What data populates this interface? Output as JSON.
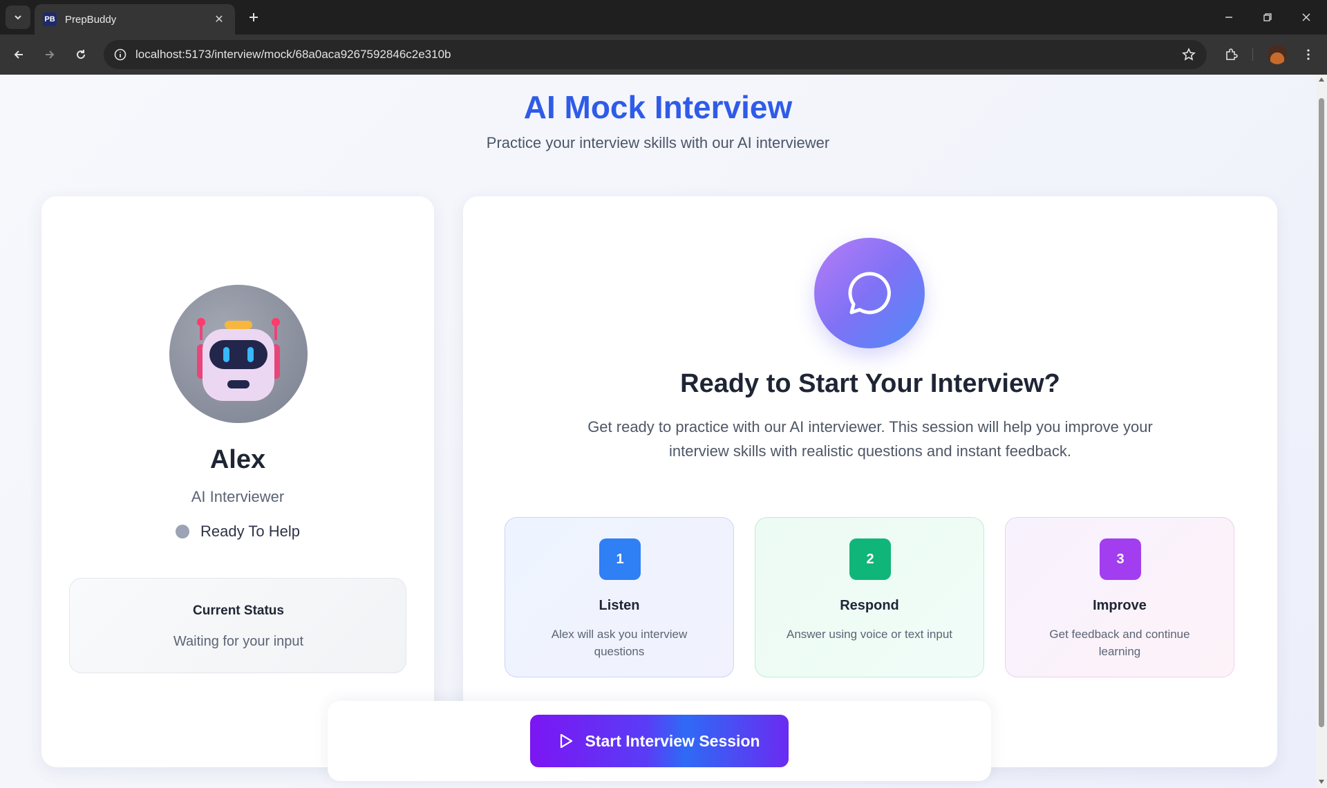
{
  "browser": {
    "tab_title": "PrepBuddy",
    "tab_favicon_text": "PB",
    "url": "localhost:5173/interview/mock/68a0aca9267592846c2e310b"
  },
  "page": {
    "title": "AI Mock Interview",
    "subtitle": "Practice your interview skills with our AI interviewer"
  },
  "agent": {
    "name": "Alex",
    "role": "AI Interviewer",
    "state": "Ready To Help",
    "status_label": "Current Status",
    "status_text": "Waiting for your input"
  },
  "intro": {
    "title": "Ready to Start Your Interview?",
    "description": "Get ready to practice with our AI interviewer. This session will help you improve your interview skills with realistic questions and instant feedback."
  },
  "steps": [
    {
      "number": "1",
      "title": "Listen",
      "description": "Alex will ask you interview questions",
      "color": "#2f7ff5"
    },
    {
      "number": "2",
      "title": "Respond",
      "description": "Answer using voice or text input",
      "color": "#10b679"
    },
    {
      "number": "3",
      "title": "Improve",
      "description": "Get feedback and continue learning",
      "color": "#a23ef0"
    }
  ],
  "actions": {
    "start_label": "Start Interview Session"
  },
  "colors": {
    "accent": "#2f5be8",
    "button_gradient_start": "#7b16f3",
    "button_gradient_end": "#2f6af5"
  }
}
